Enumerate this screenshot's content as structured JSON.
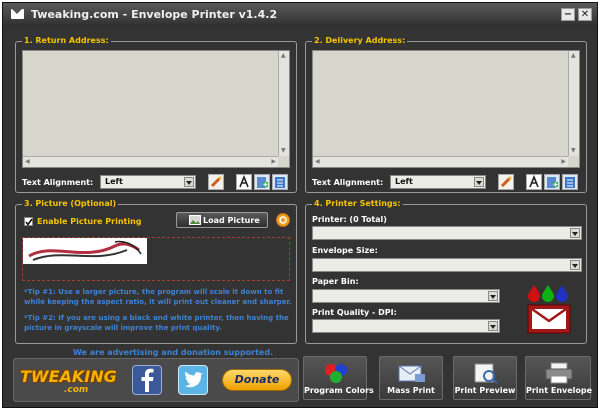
{
  "window": {
    "title": "Tweaking.com - Envelope Printer v1.4.2",
    "minimize": "−",
    "close": "✕"
  },
  "return_address": {
    "title": "1. Return Address:",
    "alignment_label": "Text Alignment:",
    "alignment_value": "Left"
  },
  "delivery_address": {
    "title": "2. Delivery Address:",
    "alignment_label": "Text Alignment:",
    "alignment_value": "Left"
  },
  "picture": {
    "title": "3. Picture (Optional)",
    "enable_label": "Enable Picture Printing",
    "enable_checked": true,
    "load_button": "Load Picture",
    "tip1": "*Tip #1: Use a larger picture, the program will scale it down to fit while keeping the aspect ratio, it will print out cleaner and sharper.",
    "tip2": "*Tip #2: If you are using a black and white printer, then having the picture in grayscale will improve the print quality."
  },
  "printer_settings": {
    "title": "4. Printer Settings:",
    "printer_label": "Printer: (0 Total)",
    "envelope_label": "Envelope Size:",
    "paper_bin_label": "Paper Bin:",
    "quality_label": "Print Quality - DPI:"
  },
  "footer": {
    "ad_text": "We are advertising and donation supported.",
    "logo_text": "TWEAKING",
    "logo_sub": ".com",
    "donate_label": "Donate",
    "buttons": {
      "program_colors": "Program Colors",
      "mass_print": "Mass Print",
      "print_preview": "Print Preview",
      "print_envelope": "Print Envelope"
    }
  },
  "colors": {
    "background": "#333333",
    "group_title": "#f5c400",
    "tip_text": "#3f82d0",
    "textarea": "#d6d6cc"
  }
}
